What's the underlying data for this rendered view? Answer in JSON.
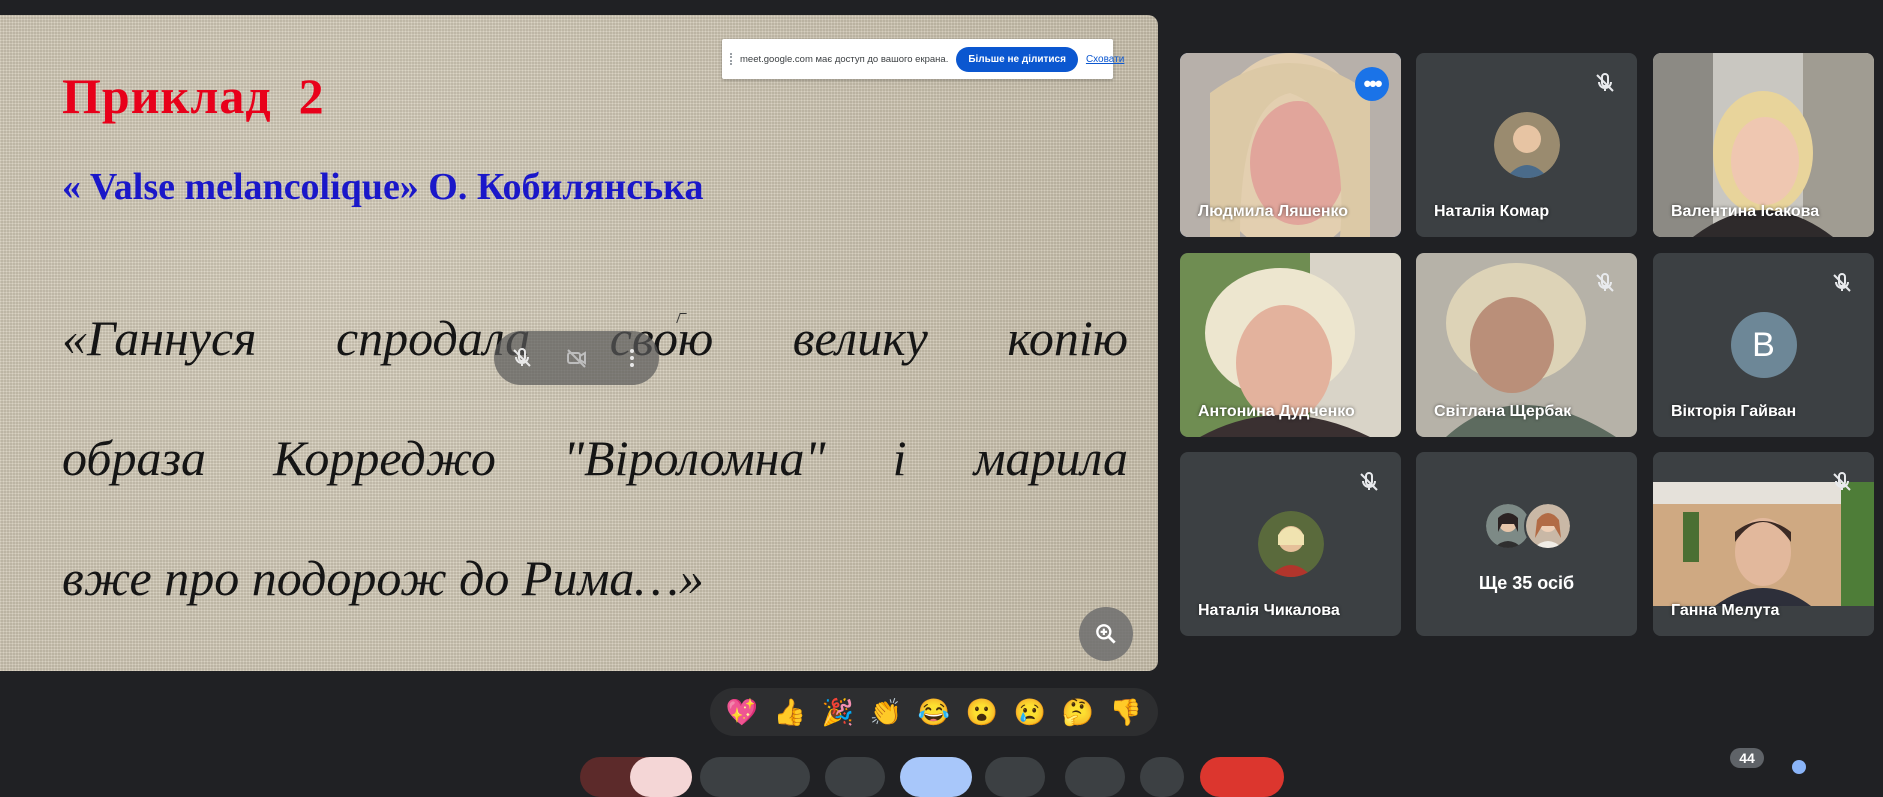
{
  "slide": {
    "title": "Приклад  2",
    "subtitle": "« Valse melancolique» О. Кобилянська",
    "quote_line1_words": [
      "«Ганнуся",
      "спродала",
      "свою",
      "велику",
      "копію"
    ],
    "quote_line2_words": [
      "образа",
      "Корреджо",
      "\"Віроломна\"",
      "і",
      "марила"
    ],
    "quote_line3": "вже про подорож до Рима…»"
  },
  "share_banner": {
    "text": "meet.google.com має доступ до вашого екрана.",
    "stop_label": "Більше не ділитися",
    "hide_label": "Сховати"
  },
  "icons": {
    "mic_off": "mic-off-icon",
    "camera_off": "camera-off-icon",
    "more": "more-vert-icon",
    "zoom": "zoom-in-icon"
  },
  "participants": [
    {
      "name": "Людмила Ляшенко",
      "muted": false,
      "active": true,
      "video": true
    },
    {
      "name": "Наталія Комар",
      "muted": true,
      "video": false
    },
    {
      "name": "Валентина Ісакова",
      "muted": false,
      "video": true
    },
    {
      "name": "Антонина Дудченко",
      "muted": false,
      "video": true
    },
    {
      "name": "Світлана Щербак",
      "muted": true,
      "video": true
    },
    {
      "name": "Вікторія Гайван",
      "muted": true,
      "video": false,
      "initial": "B"
    },
    {
      "name": "Наталія Чикалова",
      "muted": true,
      "video": false
    },
    {
      "more_label": "Ще 35 осіб"
    },
    {
      "name": "Ганна Мелута",
      "muted": true,
      "video": true
    }
  ],
  "reactions": [
    "💖",
    "👍",
    "🎉",
    "👏",
    "😂",
    "😮",
    "😢",
    "🤔",
    "👎"
  ],
  "participant_count": "44",
  "colors": {
    "accent": "#8ab4f8",
    "title_red": "#e8001a",
    "subtitle_blue": "#1a17c9",
    "background": "#202124",
    "tile": "#3c4043"
  }
}
